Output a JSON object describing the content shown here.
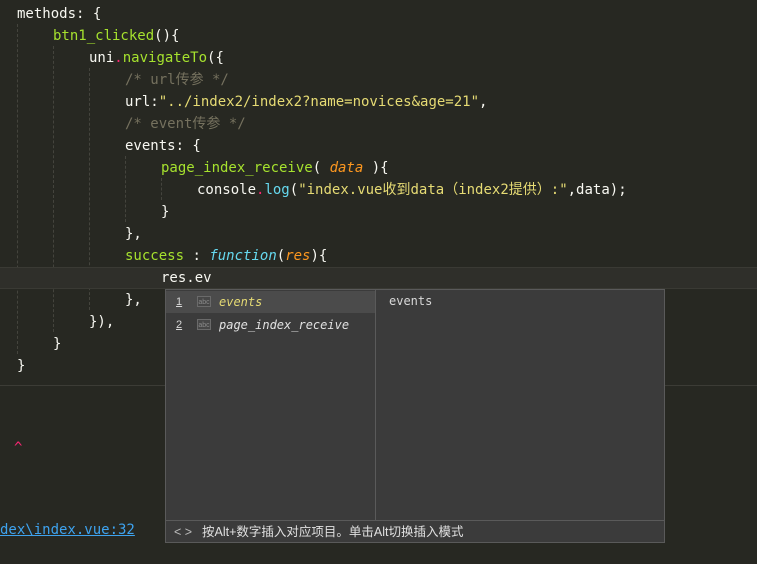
{
  "code": {
    "l1": "methods: {",
    "l2_fn": "btn1_clicked",
    "l2_rest": "(){",
    "l3_obj": "uni",
    "l3_method": "navigateTo",
    "l3_rest": "({",
    "l4_comment": "/* url传参 */",
    "l5_key": "url:",
    "l5_str": "\"../index2/index2?name=novices&age=21\"",
    "l5_end": ",",
    "l6_comment": "/* event传参 */",
    "l7": "events: {",
    "l8_fn": "page_index_receive",
    "l8_open": "( ",
    "l8_param": "data",
    "l8_close": " ){",
    "l9_obj": "console",
    "l9_method": "log",
    "l9_open": "(",
    "l9_str": "\"index.vue收到data（index2提供）:\"",
    "l9_rest": ",data);",
    "l10": "}",
    "l11": "},",
    "l12_key": "success",
    "l12_colon": " : ",
    "l12_func": "function",
    "l12_open": "(",
    "l12_param": "res",
    "l12_close": "){",
    "l13": "res.ev",
    "l14": "},",
    "l15": "}),",
    "l16": "}",
    "l17": "}"
  },
  "console": {
    "caret": "^",
    "file_link": "dex\\index.vue:32"
  },
  "autocomplete": {
    "items": [
      {
        "num": "1",
        "icon": "abc",
        "label": "events"
      },
      {
        "num": "2",
        "icon": "abc",
        "label": "page_index_receive"
      }
    ],
    "detail": "events",
    "nav": "< >",
    "hint": "按Alt+数字插入对应项目。单击Alt切换插入模式"
  },
  "colors": {
    "background": "#272822",
    "function": "#a6e22e",
    "string": "#e6db74",
    "comment": "#75715e",
    "param": "#fd971f",
    "keyword": "#66d9ef",
    "link": "#3ea3ef"
  }
}
